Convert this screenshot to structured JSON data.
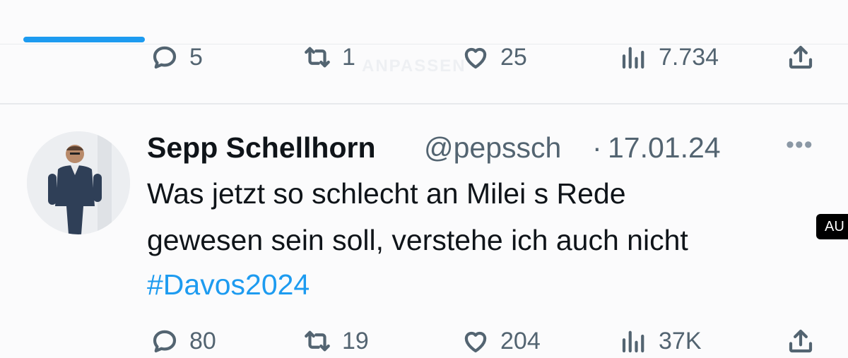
{
  "prev_tweet": {
    "watermark": "ANPASSEN",
    "replies": "5",
    "retweets": "1",
    "likes": "25",
    "views": "7.734"
  },
  "tweet": {
    "display_name": "Sepp Schellhorn",
    "handle": "@pepssch",
    "separator": "·",
    "date": "17.01.24",
    "more": "•••",
    "text_line1": "Was jetzt so schlecht an Milei s Rede",
    "text_line2": "gewesen sein soll, verstehe ich auch nicht",
    "hashtag": "#Davos2024",
    "replies": "80",
    "retweets": "19",
    "likes": "204",
    "views": "37K"
  },
  "side_badge": "AU",
  "icons": [
    "reply-icon",
    "retweet-icon",
    "like-icon",
    "views-icon",
    "share-icon"
  ]
}
